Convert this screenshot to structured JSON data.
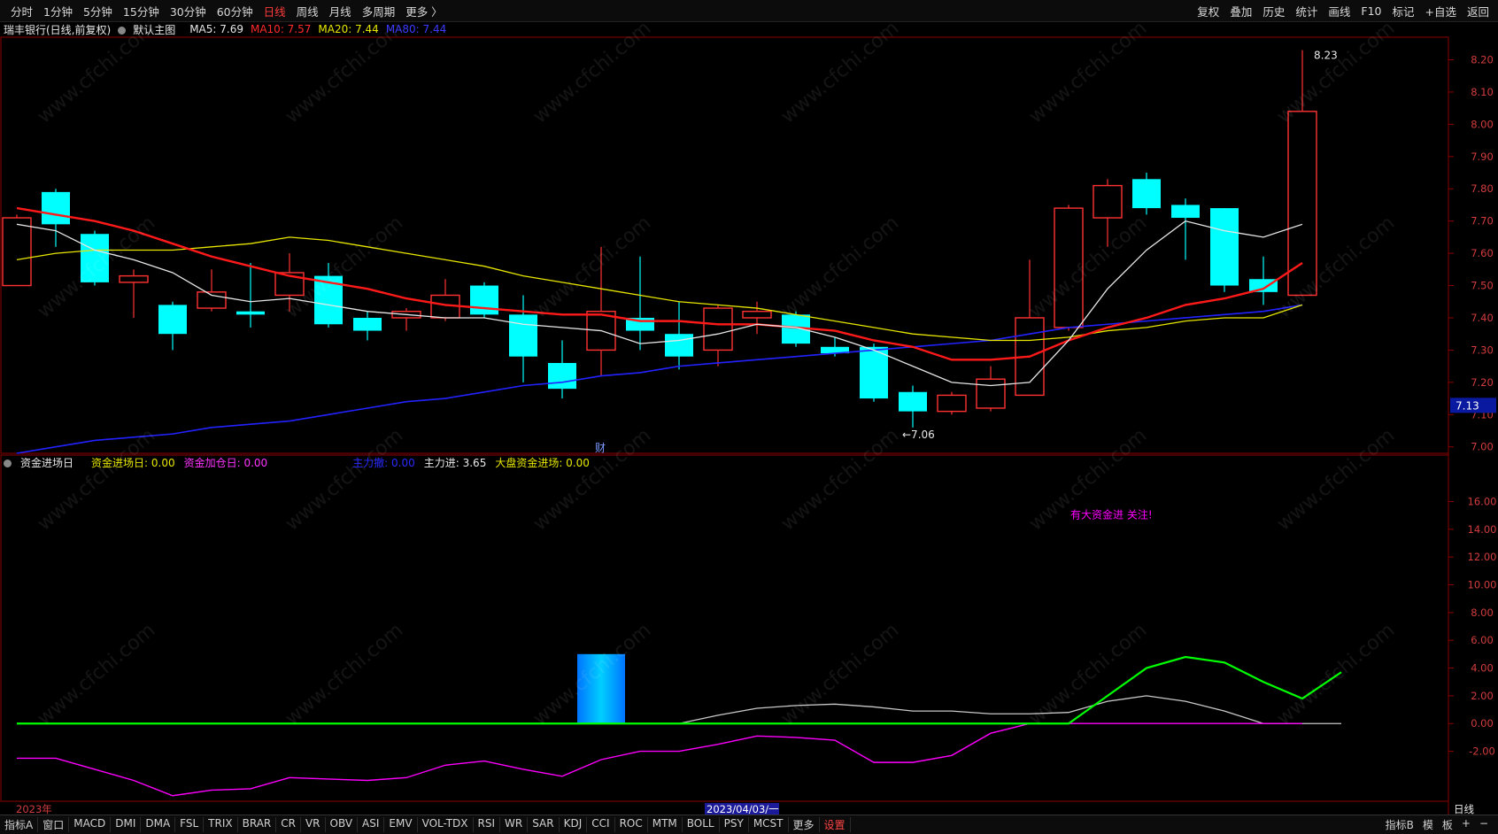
{
  "toolbar": {
    "periods": [
      "分时",
      "1分钟",
      "5分钟",
      "15分钟",
      "30分钟",
      "60分钟",
      "日线",
      "周线",
      "月线",
      "多周期",
      "更多 〉"
    ],
    "active_period": "日线",
    "right_items": [
      "复权",
      "叠加",
      "历史",
      "统计",
      "画线",
      "F10",
      "标记",
      "+自选",
      "返回"
    ]
  },
  "main_info": {
    "title": "瑞丰银行(日线,前复权)",
    "view": "默认主图",
    "ma5": "MA5: 7.69",
    "ma10": "MA10: 7.57",
    "ma20": "MA20: 7.44",
    "ma80": "MA80: 7.44"
  },
  "sub_info": {
    "title": "资金进场日",
    "field1": "资金进场日: 0.00",
    "field2": "资金加仓日: 0.00",
    "field3": "主力撤: 0.00",
    "field4": "主力进: 3.65",
    "field5": "大盘资金进场: 0.00"
  },
  "annotations": {
    "high_label": "8.23",
    "low_label": "7.06",
    "price_tag": "7.13",
    "cai_label": "财",
    "sub_annotation": "有大资金进 关注!",
    "year_label": "2023年",
    "date_label": "2023/04/03/一",
    "period_label": "日线",
    "watermark": "www.cfchi.com"
  },
  "bottom_tabs": [
    "指标A",
    "窗口",
    "MACD",
    "DMI",
    "DMA",
    "FSL",
    "TRIX",
    "BRAR",
    "CR",
    "VR",
    "OBV",
    "ASI",
    "EMV",
    "VOL-TDX",
    "RSI",
    "WR",
    "SAR",
    "KDJ",
    "CCI",
    "ROC",
    "MTM",
    "BOLL",
    "PSY",
    "MCST",
    "更多",
    "设置"
  ],
  "bottom_right": [
    "指标B",
    "模",
    "板",
    "+",
    "−"
  ],
  "colors": {
    "up": "#ff3232",
    "down": "#00ffff",
    "ma5": "#e6e6e6",
    "ma10": "#ff1a1a",
    "ma20": "#e6e600",
    "ma80": "#2222ff",
    "grid": "#8b0000",
    "green": "#00ff00",
    "magenta": "#ff00ff"
  },
  "chart_data": [
    {
      "type": "candlestick",
      "yticks": [
        "8.20",
        "8.10",
        "8.00",
        "7.90",
        "7.80",
        "7.70",
        "7.60",
        "7.50",
        "7.40",
        "7.30",
        "7.20",
        "7.10",
        "7.00"
      ],
      "ylim": [
        6.98,
        8.27
      ],
      "candles": [
        {
          "o": 7.5,
          "c": 7.71,
          "h": 7.72,
          "l": 7.5
        },
        {
          "o": 7.79,
          "c": 7.69,
          "h": 7.8,
          "l": 7.62
        },
        {
          "o": 7.66,
          "c": 7.51,
          "h": 7.67,
          "l": 7.5
        },
        {
          "o": 7.51,
          "c": 7.53,
          "h": 7.55,
          "l": 7.4
        },
        {
          "o": 7.44,
          "c": 7.35,
          "h": 7.45,
          "l": 7.3
        },
        {
          "o": 7.43,
          "c": 7.48,
          "h": 7.55,
          "l": 7.42
        },
        {
          "o": 7.42,
          "c": 7.41,
          "h": 7.57,
          "l": 7.37
        },
        {
          "o": 7.47,
          "c": 7.54,
          "h": 7.6,
          "l": 7.42
        },
        {
          "o": 7.53,
          "c": 7.38,
          "h": 7.57,
          "l": 7.37
        },
        {
          "o": 7.4,
          "c": 7.36,
          "h": 7.42,
          "l": 7.33
        },
        {
          "o": 7.4,
          "c": 7.42,
          "h": 7.43,
          "l": 7.36
        },
        {
          "o": 7.4,
          "c": 7.47,
          "h": 7.52,
          "l": 7.39
        },
        {
          "o": 7.5,
          "c": 7.41,
          "h": 7.51,
          "l": 7.4
        },
        {
          "o": 7.41,
          "c": 7.28,
          "h": 7.47,
          "l": 7.2
        },
        {
          "o": 7.26,
          "c": 7.18,
          "h": 7.33,
          "l": 7.15
        },
        {
          "o": 7.3,
          "c": 7.42,
          "h": 7.62,
          "l": 7.22
        },
        {
          "o": 7.4,
          "c": 7.36,
          "h": 7.59,
          "l": 7.3
        },
        {
          "o": 7.35,
          "c": 7.28,
          "h": 7.45,
          "l": 7.24
        },
        {
          "o": 7.3,
          "c": 7.43,
          "h": 7.44,
          "l": 7.25
        },
        {
          "o": 7.4,
          "c": 7.42,
          "h": 7.45,
          "l": 7.35
        },
        {
          "o": 7.41,
          "c": 7.32,
          "h": 7.42,
          "l": 7.31
        },
        {
          "o": 7.31,
          "c": 7.29,
          "h": 7.34,
          "l": 7.28
        },
        {
          "o": 7.31,
          "c": 7.15,
          "h": 7.32,
          "l": 7.14
        },
        {
          "o": 7.17,
          "c": 7.11,
          "h": 7.19,
          "l": 7.06
        },
        {
          "o": 7.11,
          "c": 7.16,
          "h": 7.17,
          "l": 7.1
        },
        {
          "o": 7.12,
          "c": 7.21,
          "h": 7.25,
          "l": 7.11
        },
        {
          "o": 7.16,
          "c": 7.4,
          "h": 7.58,
          "l": 7.16
        },
        {
          "o": 7.37,
          "c": 7.74,
          "h": 7.75,
          "l": 7.36
        },
        {
          "o": 7.71,
          "c": 7.81,
          "h": 7.83,
          "l": 7.62
        },
        {
          "o": 7.83,
          "c": 7.74,
          "h": 7.85,
          "l": 7.72
        },
        {
          "o": 7.75,
          "c": 7.71,
          "h": 7.77,
          "l": 7.58
        },
        {
          "o": 7.74,
          "c": 7.5,
          "h": 7.74,
          "l": 7.48
        },
        {
          "o": 7.52,
          "c": 7.48,
          "h": 7.59,
          "l": 7.44
        },
        {
          "o": 7.47,
          "c": 8.04,
          "h": 8.23,
          "l": 7.47
        }
      ],
      "ma5": [
        7.69,
        7.67,
        7.61,
        7.58,
        7.54,
        7.47,
        7.45,
        7.46,
        7.44,
        7.42,
        7.41,
        7.4,
        7.4,
        7.38,
        7.37,
        7.36,
        7.32,
        7.33,
        7.35,
        7.38,
        7.37,
        7.34,
        7.3,
        7.25,
        7.2,
        7.19,
        7.2,
        7.33,
        7.49,
        7.61,
        7.7,
        7.67,
        7.65,
        7.69
      ],
      "ma10": [
        7.74,
        7.72,
        7.7,
        7.67,
        7.63,
        7.59,
        7.56,
        7.53,
        7.51,
        7.49,
        7.46,
        7.44,
        7.43,
        7.42,
        7.41,
        7.41,
        7.39,
        7.39,
        7.38,
        7.38,
        7.37,
        7.36,
        7.33,
        7.31,
        7.27,
        7.27,
        7.28,
        7.33,
        7.37,
        7.4,
        7.44,
        7.46,
        7.49,
        7.57
      ],
      "ma20": [
        7.58,
        7.6,
        7.61,
        7.61,
        7.61,
        7.62,
        7.63,
        7.65,
        7.64,
        7.62,
        7.6,
        7.58,
        7.56,
        7.53,
        7.51,
        7.49,
        7.47,
        7.45,
        7.44,
        7.43,
        7.41,
        7.39,
        7.37,
        7.35,
        7.34,
        7.33,
        7.33,
        7.34,
        7.36,
        7.37,
        7.39,
        7.4,
        7.4,
        7.44
      ],
      "ma80": [
        6.98,
        7.0,
        7.02,
        7.03,
        7.04,
        7.06,
        7.07,
        7.08,
        7.1,
        7.12,
        7.14,
        7.15,
        7.17,
        7.19,
        7.2,
        7.22,
        7.23,
        7.25,
        7.26,
        7.27,
        7.28,
        7.29,
        7.3,
        7.31,
        7.32,
        7.33,
        7.35,
        7.37,
        7.38,
        7.39,
        7.4,
        7.41,
        7.42,
        7.44
      ]
    },
    {
      "type": "indicator",
      "yticks": [
        "16.00",
        "14.00",
        "12.00",
        "10.00",
        "8.00",
        "6.00",
        "4.00",
        "2.00",
        "0.00",
        "-2.00"
      ],
      "ylim": [
        -5.6,
        18.2
      ],
      "bar": {
        "index": 15,
        "value": 5.0
      },
      "green": [
        0,
        0,
        0,
        0,
        0,
        0,
        0,
        0,
        0,
        0,
        0,
        0,
        0,
        0,
        0,
        0,
        0,
        0,
        0,
        0,
        0,
        0,
        0,
        0,
        0,
        0,
        0,
        0,
        2.0,
        4.0,
        4.8,
        4.4,
        3.0,
        1.8,
        3.7
      ],
      "white": [
        0,
        0,
        0,
        0,
        0,
        0,
        0,
        0,
        0,
        0,
        0,
        0,
        0,
        0,
        0,
        0,
        0,
        0,
        0.6,
        1.1,
        1.3,
        1.4,
        1.2,
        0.9,
        0.9,
        0.7,
        0.7,
        0.8,
        1.6,
        2.0,
        1.6,
        0.9,
        0,
        0,
        0
      ],
      "magenta": [
        -2.5,
        -2.5,
        -3.3,
        -4.1,
        -5.2,
        -4.8,
        -4.7,
        -3.9,
        -4.0,
        -4.1,
        -3.9,
        -3.0,
        -2.7,
        -3.3,
        -3.8,
        -2.6,
        -2.0,
        -2.0,
        -1.5,
        -0.9,
        -1.0,
        -1.2,
        -2.8,
        -2.8,
        -2.3,
        -0.7,
        0,
        0,
        0,
        0,
        0,
        0,
        0,
        0
      ]
    }
  ]
}
